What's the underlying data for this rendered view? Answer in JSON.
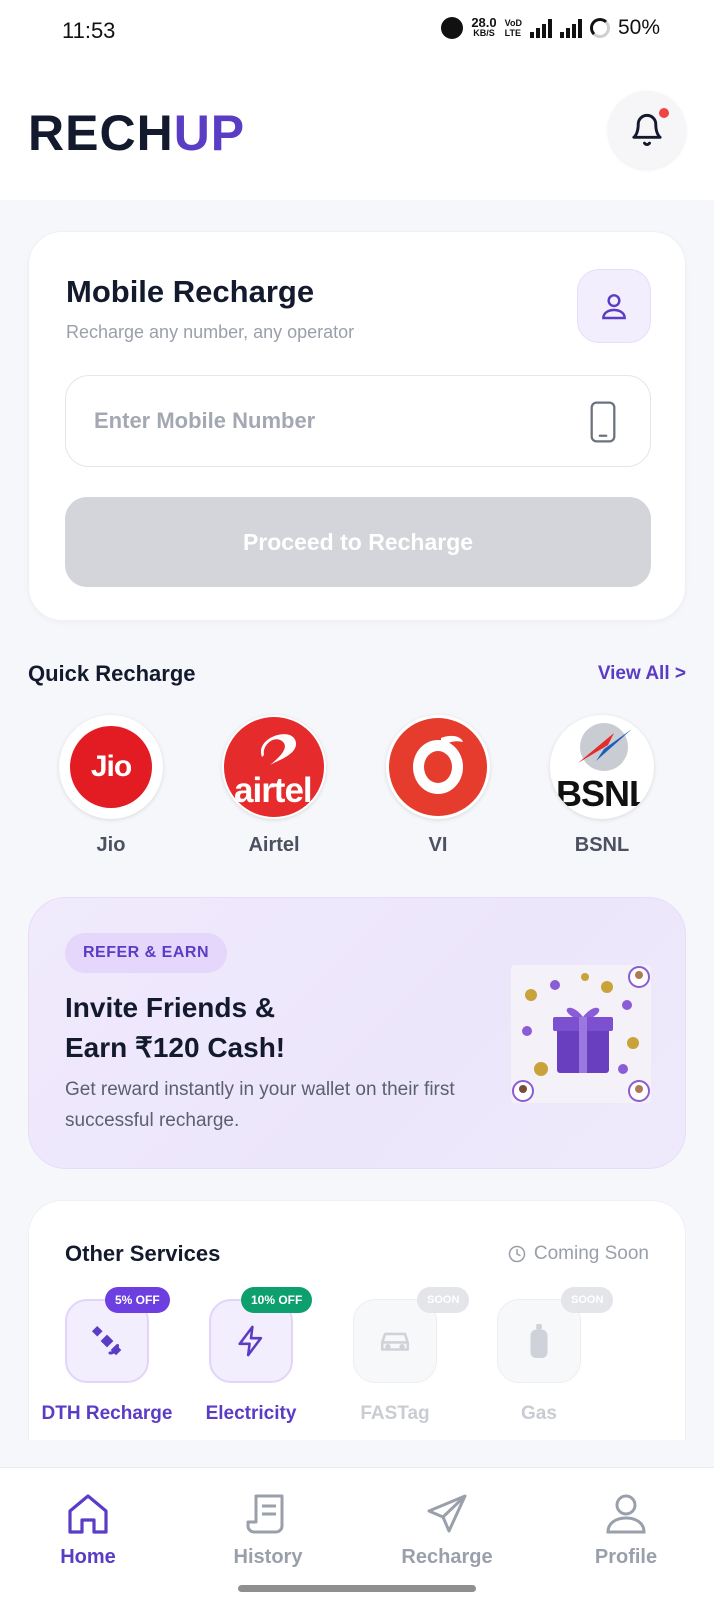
{
  "status_bar": {
    "time": "11:53",
    "net_speed": "28.0",
    "net_unit": "KB/S",
    "volte_top": "VoD",
    "volte_bottom": "LTE",
    "battery": "50%"
  },
  "header": {
    "logo_part1": "RECH",
    "logo_part2": "UP",
    "has_notification": true
  },
  "mobile_recharge": {
    "title": "Mobile Recharge",
    "subtitle": "Recharge any number, any operator",
    "input_placeholder": "Enter Mobile Number",
    "proceed_label": "Proceed to Recharge"
  },
  "quick_recharge": {
    "title": "Quick Recharge",
    "view_all": "View All >",
    "operators": [
      {
        "name": "Jio",
        "logo_text": "Jio"
      },
      {
        "name": "Airtel",
        "logo_text": "airtel"
      },
      {
        "name": "VI",
        "logo_text": ""
      },
      {
        "name": "BSNL",
        "logo_text": "BSNL"
      }
    ]
  },
  "promo": {
    "badge": "REFER & EARN",
    "title_line1": "Invite Friends &",
    "title_line2": "Earn ₹120 Cash!",
    "description": "Get reward instantly in your wallet on their first successful recharge."
  },
  "other_services": {
    "title": "Other Services",
    "status": "Coming Soon",
    "items": [
      {
        "label": "DTH Recharge",
        "tag": "5% OFF",
        "enabled": true,
        "icon": "satellite-icon"
      },
      {
        "label": "Electricity",
        "tag": "10% OFF",
        "enabled": true,
        "icon": "lightning-icon"
      },
      {
        "label": "FASTag",
        "tag": "SOON",
        "enabled": false,
        "icon": "car-icon"
      },
      {
        "label": "Gas",
        "tag": "SOON",
        "enabled": false,
        "icon": "gas-cylinder-icon"
      }
    ]
  },
  "bottom_nav": {
    "items": [
      {
        "label": "Home",
        "icon": "home-icon",
        "active": true
      },
      {
        "label": "History",
        "icon": "receipt-icon",
        "active": false
      },
      {
        "label": "Recharge",
        "icon": "send-icon",
        "active": false
      },
      {
        "label": "Profile",
        "icon": "user-icon",
        "active": false
      }
    ]
  },
  "colors": {
    "brand": "#5b3cc4",
    "dark": "#141a2e",
    "muted": "#9aa0ab",
    "discount_purple": "#6d3ee0",
    "discount_green": "#0e9f6e"
  }
}
